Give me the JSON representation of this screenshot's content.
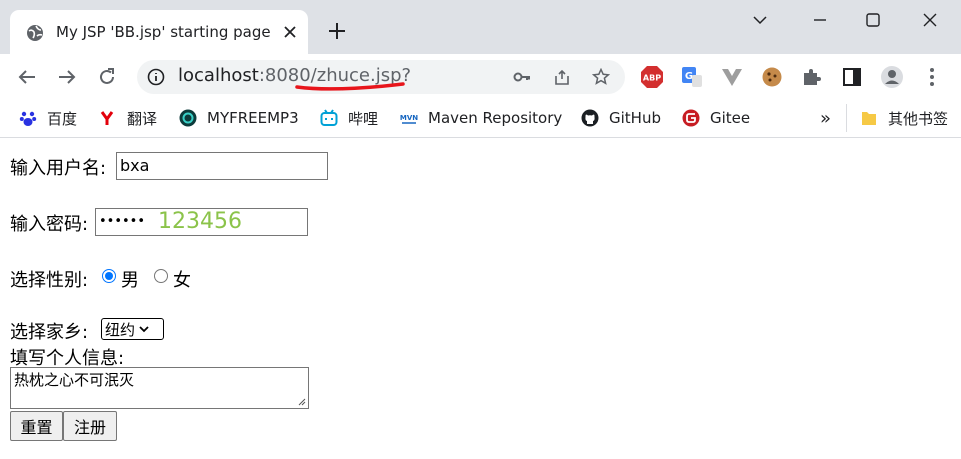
{
  "browser": {
    "tab_title": "My JSP 'BB.jsp' starting page",
    "url_host": "localhost",
    "url_rest": ":8080/zhuce.jsp?",
    "annotation_color": "#e8151b",
    "bookmarks": [
      {
        "label": "百度",
        "icon": "baidu-paw-icon"
      },
      {
        "label": "翻译",
        "icon": "youdao-icon"
      },
      {
        "label": "MYFREEMP3",
        "icon": "music-icon"
      },
      {
        "label": "哔哩",
        "icon": "bilibili-icon"
      },
      {
        "label": "Maven Repository",
        "icon": "maven-icon"
      },
      {
        "label": "GitHub",
        "icon": "github-icon"
      },
      {
        "label": "Gitee",
        "icon": "gitee-icon"
      }
    ],
    "more_bookmarks": "»",
    "other_bookmarks": "其他书签"
  },
  "form": {
    "username_label": "输入用户名:",
    "username_value": "bxa",
    "password_label": "输入密码:",
    "password_mask": "••••••",
    "password_annotation": "123456",
    "password_annotation_color": "#8bc34a",
    "gender_label": "选择性别:",
    "gender_options": [
      "男",
      "女"
    ],
    "gender_selected": "男",
    "hometown_label": "选择家乡:",
    "hometown_value": "纽约",
    "info_label": "填写个人信息:",
    "info_value": "热枕之心不可泯灭",
    "reset_label": "重置",
    "submit_label": "注册"
  }
}
